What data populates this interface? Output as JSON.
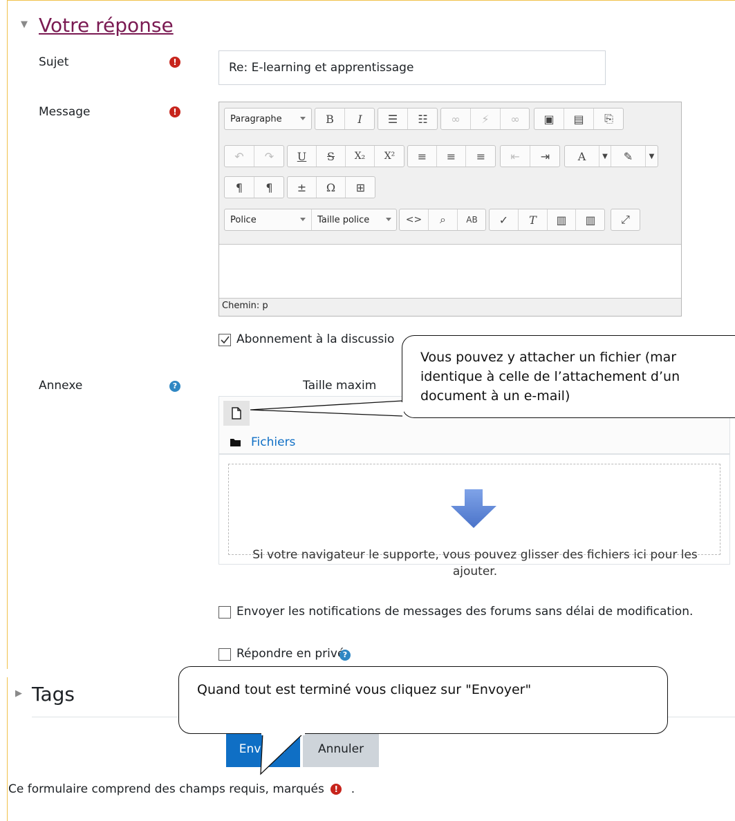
{
  "section": {
    "title": "Votre réponse"
  },
  "fields": {
    "subject": {
      "label": "Sujet",
      "value": "Re: E-learning et apprentissage"
    },
    "message": {
      "label": "Message"
    },
    "attachment": {
      "label": "Annexe",
      "max_size_label": "Taille maxim"
    }
  },
  "editor": {
    "paragraph_label": "Paragraphe",
    "font_label": "Police",
    "font_size_label": "Taille police",
    "path_label": "Chemin: p"
  },
  "checkboxes": {
    "subscribe": {
      "label": "Abonnement à la discussio",
      "checked": true
    },
    "notify": {
      "label": "Envoyer les notifications de messages des forums sans délai de modification.",
      "checked": false
    },
    "private": {
      "label": "Répondre en privé",
      "checked": false
    }
  },
  "filepicker": {
    "folder_label": "Fichiers",
    "drop_text_line1": "Si votre navigateur le supporte, vous pouvez glisser des fichiers ici pour les",
    "drop_text_line2": "ajouter."
  },
  "tags": {
    "title": "Tags"
  },
  "buttons": {
    "submit": "Envoyer",
    "cancel": "Annuler"
  },
  "footer": {
    "required_note": "Ce formulaire comprend des champs requis, marqués",
    "required_note_end": "."
  },
  "callouts": {
    "attachment_line1": "Vous pouvez y attacher un fichier (mar",
    "attachment_line2": "identique à celle de l’attachement d’un",
    "attachment_line3": "document à un e-mail)",
    "submit": "Quand tout est terminé vous cliquez sur \"Envoyer\""
  },
  "colors": {
    "required": "#c7241c",
    "help": "#2f87c3",
    "primary": "#0f6fc5",
    "section_link": "#7a1a52",
    "frame": "#f0c14b",
    "drop_arrow": "#5b84d6"
  },
  "icons": [
    "caret-down-icon",
    "required-icon",
    "help-icon",
    "file-add-icon",
    "folder-icon",
    "download-arrow-icon",
    "caret-right-icon"
  ]
}
